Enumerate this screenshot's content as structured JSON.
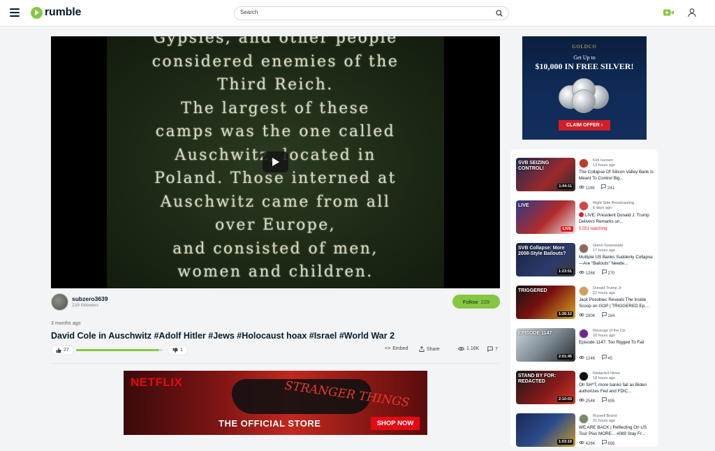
{
  "header": {
    "logo_text": "rumble",
    "search_placeholder": "Search"
  },
  "player": {
    "caption_lines": [
      "Gypsies, and other people",
      "considered enemies of the",
      "Third Reich.",
      "The largest of these",
      "camps was the one called",
      "Auschwitz, located in",
      "Poland. Those interned at",
      "Auschwitz came from all",
      "over Europe,",
      "and consisted of men,",
      "women and children."
    ]
  },
  "channel": {
    "name": "subzero3639",
    "followers": "229 followers",
    "follow_label": "Follow",
    "follow_count": "229"
  },
  "video": {
    "posted": "3 months ago",
    "title": "David Cole in Auschwitz #Adolf Hitler #Jews #Holocaust hoax #Israel #World War 2",
    "likes": "27",
    "dislikes": "1",
    "vote_ratio": 0.96,
    "embed_label": "Embed",
    "share_label": "Share",
    "views": "1.16K",
    "comments": "7"
  },
  "ad_side": {
    "brand": "GOLDCO",
    "line1": "Get Up to",
    "line2": "$10,000 IN FREE SILVER!",
    "cta": "CLAIM OFFER ›"
  },
  "ad_bottom": {
    "brand": "NETFLIX",
    "show": "STRANGER THINGS",
    "tagline": "THE OFFICIAL STORE",
    "cta": "SHOP NOW"
  },
  "sidebar": {
    "items": [
      {
        "channel": "Kim Iversen",
        "ago": "13 hours ago",
        "title": "The Collapse Of Silicon Valley Bank Is Meant To Control Big...",
        "views": "119K",
        "comments": "241",
        "duration": "1:04:11",
        "thumb_text": "SVB SEIZING CONTROL!",
        "live": false
      },
      {
        "channel": "Right Side Broadcasting...",
        "ago": "6 days ago",
        "title": "LIVE: President Donald J. Trump Delivers Remarks on...",
        "watching": "5,051 watching",
        "thumb_text": "LIVE",
        "live": true
      },
      {
        "channel": "Glenn Greenwald",
        "ago": "17 hours ago",
        "title": "Multiple US Banks Suddenly Collapse—Are \"Bailouts\" Neede...",
        "views": "126K",
        "comments": "270",
        "duration": "1:23:51",
        "thumb_text": "SVB Collapse: More 2008-Style Bailouts?",
        "live": false
      },
      {
        "channel": "Donald Trump Jr.",
        "ago": "22 hours ago",
        "title": "Jack Posobiec Reveals The Inside Scoop on GOP | TRIGGERED Ep....",
        "views": "280K",
        "comments": "164",
        "duration": "1:26:12",
        "thumb_text": "TRIGGERED",
        "live": false
      },
      {
        "channel": "Revenge of the Cis",
        "ago": "18 hours ago",
        "title": "Episode 1147: Too Rigged To Fail",
        "views": "124K",
        "comments": "45",
        "duration": "2:01:45",
        "thumb_text": "EPISODE 1147",
        "live": false
      },
      {
        "channel": "Redacted News",
        "ago": "18 hours ago",
        "title": "Oh SH*T, more banks fail as Biden authorizes Fed and FDIC...",
        "views": "254K",
        "comments": "655",
        "duration": "2:10:03",
        "thumb_text": "STAND BY FOR: REDACTED",
        "live": false
      },
      {
        "channel": "Russell Brand",
        "ago": "21 hours ago",
        "title": "WE ARE BACK | Reflecting On US Tour Plus MORE... #089 Stay Fr...",
        "views": "426K",
        "comments": "656",
        "duration": "1:03:19",
        "thumb_text": "",
        "live": false
      }
    ]
  },
  "colors": {
    "accent": "#85c742",
    "text": "#061b2b",
    "live": "#e22028"
  }
}
